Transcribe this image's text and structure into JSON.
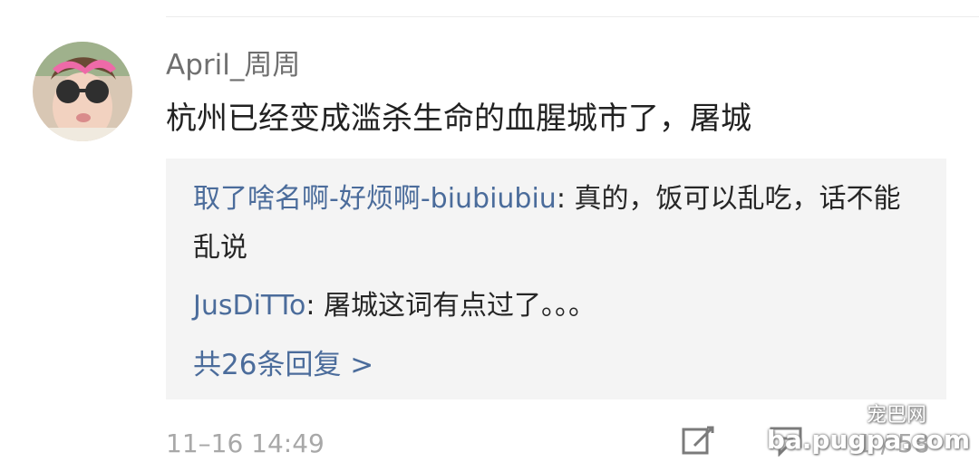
{
  "comment": {
    "username": "April_周周",
    "text": "杭州已经变成滥杀生命的血腥城市了，屠城",
    "timestamp": "11–16 14:49"
  },
  "replies": [
    {
      "user": "取了啥名啊-好烦啊-biubiubiu",
      "separator": ": ",
      "text": "真的，饭可以乱吃，话不能乱说"
    },
    {
      "user": "JusDiTTo",
      "separator": ": ",
      "text": "屠城这词有点过了。。。"
    }
  ],
  "more_replies": "共26条回复 >",
  "actions": {
    "share_icon": "share-edit-icon",
    "reply_icon": "comment-bubble-icon",
    "counter": "1 / 58"
  },
  "watermark": {
    "top": "宠巴网",
    "bottom": "ba.pugpa.com"
  },
  "colors": {
    "link": "#4b6c9b",
    "reply_background": "#f4f4f4",
    "meta": "#a8a8a8"
  }
}
